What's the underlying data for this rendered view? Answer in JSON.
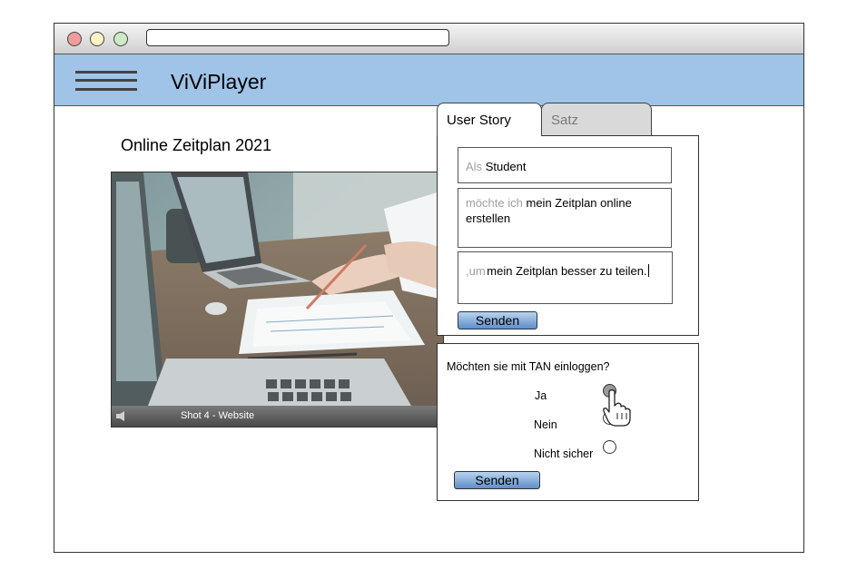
{
  "app": {
    "title": "ViViPlayer"
  },
  "video": {
    "title": "Online Zeitplan 2021",
    "shot_label": "Shot 4 - Website"
  },
  "tabs": [
    {
      "label": "User Story",
      "active": true
    },
    {
      "label": "Satz",
      "active": false
    }
  ],
  "story": {
    "role_prefix": "Als",
    "role_value": "Student",
    "goal_prefix": "möchte ich",
    "goal_value": "mein Zeitplan online erstellen",
    "reason_prefix": ",um",
    "reason_value": "mein Zeitplan besser zu teilen.",
    "submit_label": "Senden"
  },
  "tan": {
    "question": "Möchten sie mit TAN einloggen?",
    "options": [
      {
        "label": "Ja",
        "checked": true
      },
      {
        "label": "Nein",
        "checked": false
      },
      {
        "label": "Nicht sicher",
        "checked": false
      }
    ],
    "submit_label": "Senden"
  },
  "colors": {
    "appbar": "#9fc4e7",
    "button": "#7fa8d9",
    "inactive_tab": "#d9d9d9"
  },
  "icons": [
    "menu-icon",
    "speaker-icon",
    "hand-pointer-icon"
  ]
}
